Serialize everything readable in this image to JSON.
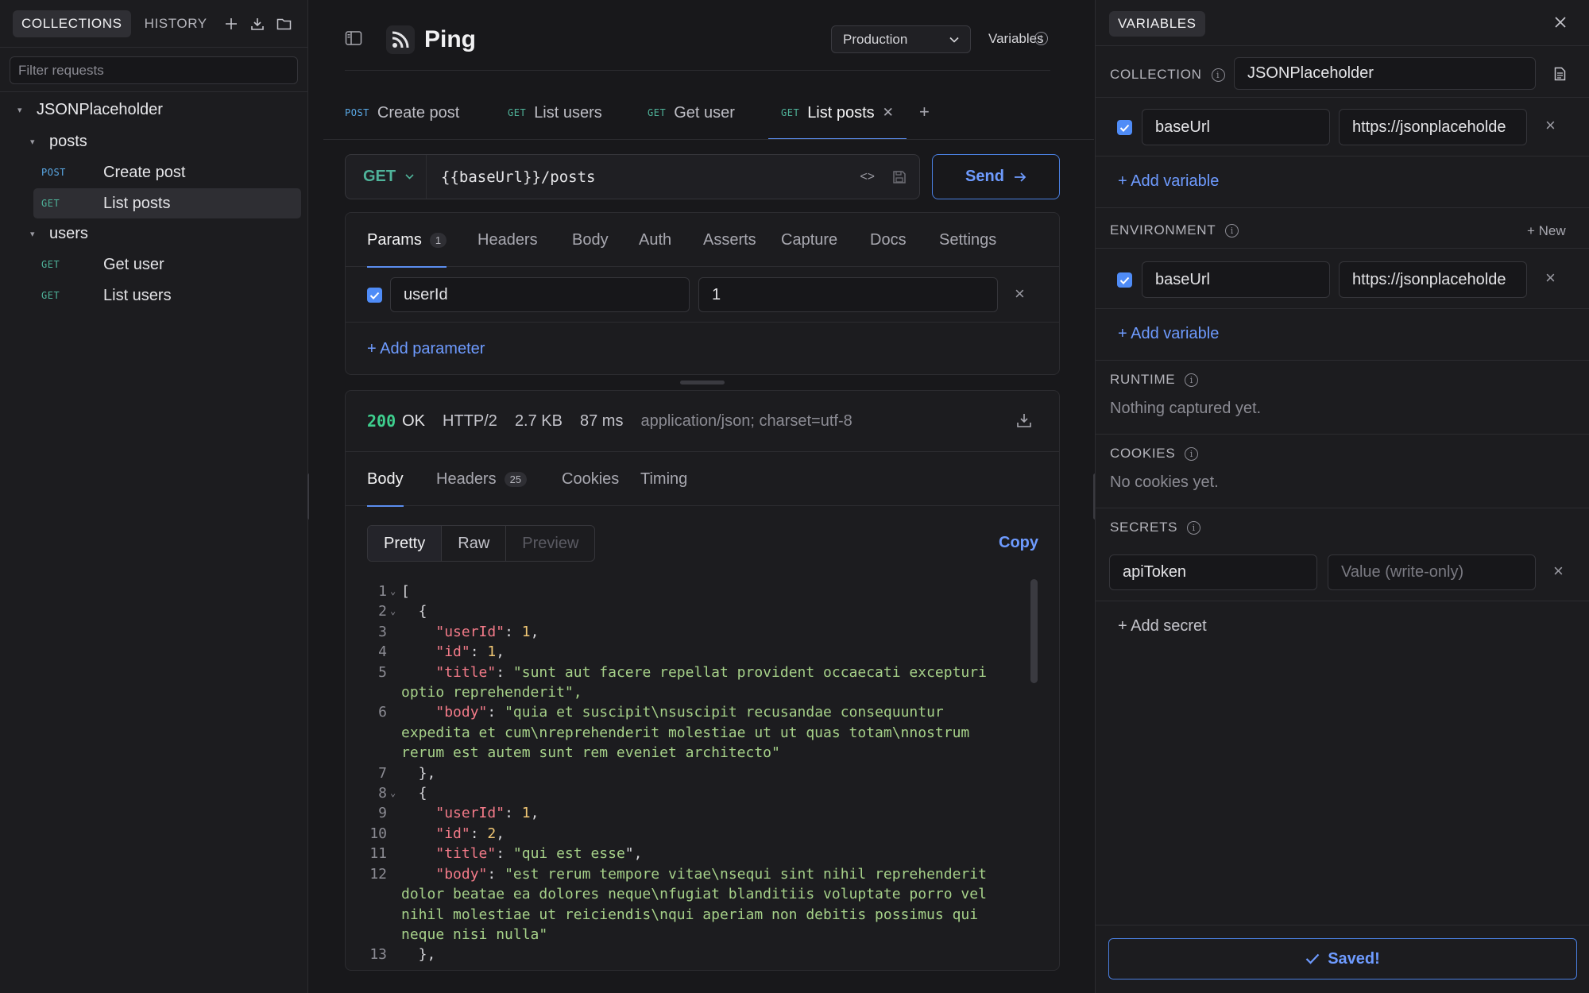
{
  "colors": {
    "accent": "#5b8def",
    "get": "#4fb39a",
    "post": "#5aa9e6",
    "status_ok": "#3ecf8e"
  },
  "sidebar": {
    "tabs": [
      "COLLECTIONS",
      "HISTORY"
    ],
    "filter_placeholder": "Filter requests",
    "collection": "JSONPlaceholder",
    "folders": [
      {
        "name": "posts",
        "requests": [
          {
            "method": "POST",
            "name": "Create post"
          },
          {
            "method": "GET",
            "name": "List posts",
            "active": true
          }
        ]
      },
      {
        "name": "users",
        "requests": [
          {
            "method": "GET",
            "name": "Get user"
          },
          {
            "method": "GET",
            "name": "List users"
          }
        ]
      }
    ]
  },
  "header": {
    "title": "Ping",
    "environment": "Production",
    "variables_label": "Variables"
  },
  "tabs": [
    {
      "method": "POST",
      "name": "Create post"
    },
    {
      "method": "GET",
      "name": "List users"
    },
    {
      "method": "GET",
      "name": "Get user"
    },
    {
      "method": "GET",
      "name": "List posts",
      "active": true
    }
  ],
  "request": {
    "method": "GET",
    "url": "{{baseUrl}}/posts",
    "send_label": "Send",
    "tabs": [
      "Params",
      "Headers",
      "Body",
      "Auth",
      "Asserts",
      "Capture",
      "Docs",
      "Settings"
    ],
    "params_count": "1",
    "params": [
      {
        "key": "userId",
        "value": "1",
        "enabled": true
      }
    ],
    "add_param_label": "+ Add parameter"
  },
  "response": {
    "status_code": "200",
    "status_text": "OK",
    "protocol": "HTTP/2",
    "size": "2.7 KB",
    "time": "87 ms",
    "content_type": "application/json; charset=utf-8",
    "tabs": [
      "Body",
      "Headers",
      "Cookies",
      "Timing"
    ],
    "headers_count": "25",
    "views": [
      "Pretty",
      "Raw",
      "Preview"
    ],
    "copy_label": "Copy",
    "lines": [
      {
        "n": "1",
        "fold": true,
        "text": "["
      },
      {
        "n": "2",
        "fold": true,
        "text": "  {"
      },
      {
        "n": "3",
        "text": "    \"userId\": 1,"
      },
      {
        "n": "4",
        "text": "    \"id\": 1,"
      },
      {
        "n": "5",
        "text": "    \"title\": \"sunt aut facere repellat provident occaecati excepturi"
      },
      {
        "n": "",
        "text": "optio reprehenderit\","
      },
      {
        "n": "6",
        "text": "    \"body\": \"quia et suscipit\\nsuscipit recusandae consequuntur"
      },
      {
        "n": "",
        "text": "expedita et cum\\nreprehenderit molestiae ut ut quas totam\\nnostrum"
      },
      {
        "n": "",
        "text": "rerum est autem sunt rem eveniet architecto\""
      },
      {
        "n": "7",
        "text": "  },"
      },
      {
        "n": "8",
        "fold": true,
        "text": "  {"
      },
      {
        "n": "9",
        "text": "    \"userId\": 1,"
      },
      {
        "n": "10",
        "text": "    \"id\": 2,"
      },
      {
        "n": "11",
        "text": "    \"title\": \"qui est esse\","
      },
      {
        "n": "12",
        "text": "    \"body\": \"est rerum tempore vitae\\nsequi sint nihil reprehenderit"
      },
      {
        "n": "",
        "text": "dolor beatae ea dolores neque\\nfugiat blanditiis voluptate porro vel"
      },
      {
        "n": "",
        "text": "nihil molestiae ut reiciendis\\nqui aperiam non debitis possimus qui"
      },
      {
        "n": "",
        "text": "neque nisi nulla\""
      },
      {
        "n": "13",
        "text": "  },"
      }
    ]
  },
  "variables": {
    "title": "VARIABLES",
    "collection_label": "COLLECTION",
    "collection_name": "JSONPlaceholder",
    "collection_vars": [
      {
        "key": "baseUrl",
        "value": "https://jsonplaceholde",
        "enabled": true
      }
    ],
    "add_variable_label": "+ Add variable",
    "environment_label": "ENVIRONMENT",
    "new_label": "+ New",
    "environment_vars": [
      {
        "key": "baseUrl",
        "value": "https://jsonplaceholde",
        "enabled": true
      }
    ],
    "runtime_label": "RUNTIME",
    "runtime_empty": "Nothing captured yet.",
    "cookies_label": "COOKIES",
    "cookies_empty": "No cookies yet.",
    "secrets_label": "SECRETS",
    "secret_key": "apiToken",
    "secret_placeholder": "Value (write-only)",
    "add_secret_label": "+ Add secret",
    "saved_label": "Saved!"
  }
}
